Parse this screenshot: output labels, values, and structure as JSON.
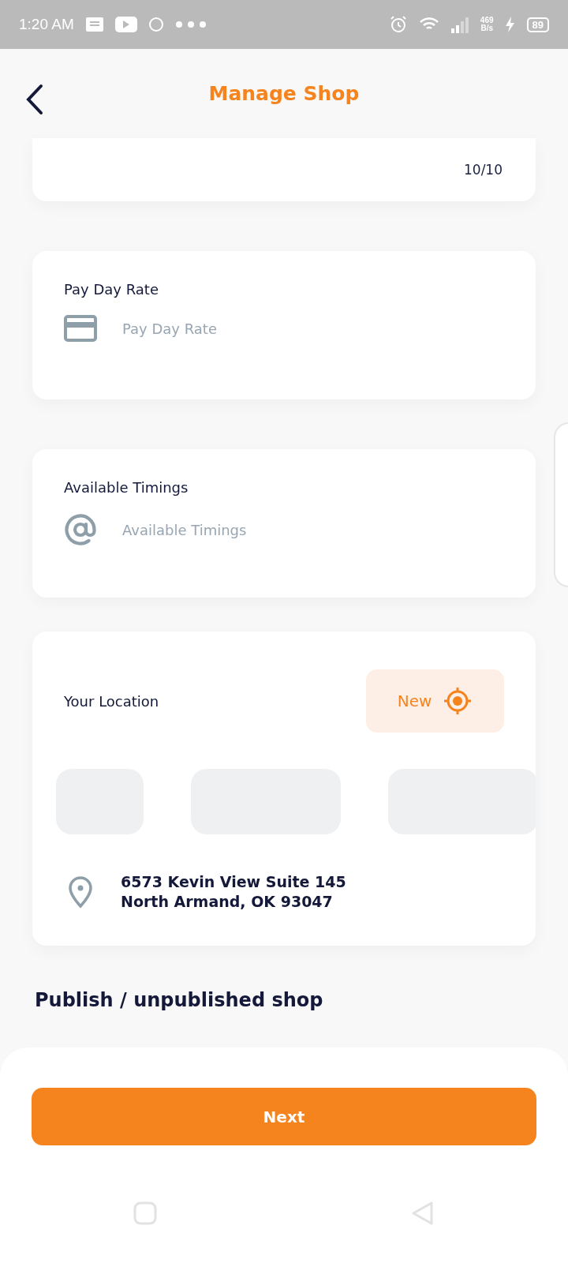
{
  "status_bar": {
    "time": "1:20 AM",
    "net_speed_value": "469",
    "net_speed_unit": "B/s",
    "battery": "89"
  },
  "header": {
    "title": "Manage Shop"
  },
  "counter_card": {
    "counter": "10/10"
  },
  "fields": [
    {
      "label": "Pay Day Rate",
      "placeholder": "Pay Day Rate",
      "kind": "card"
    },
    {
      "label": "Available Timings",
      "placeholder": "Available Timings",
      "kind": "at"
    }
  ],
  "location": {
    "label": "Your Location",
    "button": "New",
    "address_line_1": "6573 Kevin View Suite 145",
    "address_line_2": "North Armand, OK 93047"
  },
  "section_title": "Publish / unpublished shop",
  "next_button": "Next"
}
